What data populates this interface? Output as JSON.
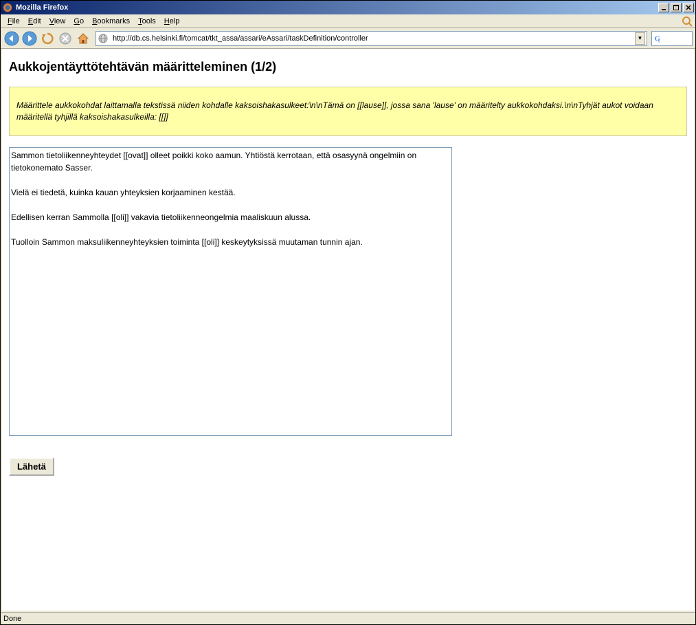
{
  "window": {
    "title": "Mozilla Firefox"
  },
  "menu": {
    "file": "File",
    "edit": "Edit",
    "view": "View",
    "go": "Go",
    "bookmarks": "Bookmarks",
    "tools": "Tools",
    "help": "Help"
  },
  "toolbar": {
    "url": "http://db.cs.helsinki.fi/tomcat/tkt_assa/assari/eAssari/taskDefinition/controller",
    "search_letter": "G"
  },
  "page": {
    "title": "Aukkojentäyttötehtävän määritteleminen (1/2)",
    "info": "Määrittele aukkokohdat laittamalla tekstissä niiden kohdalle kaksoishakasulkeet:\\n\\nTämä on [[lause]], jossa sana 'lause' on määritelty aukkokohdaksi.\\n\\nTyhjät aukot voidaan määritellä tyhjillä kaksoishakasulkeilla: [[]]",
    "textarea": "Sammon tietoliikenneyhteydet [[ovat]] olleet poikki koko aamun. Yhtiöstä kerrotaan, että osasyynä ongelmiin on tietokonemato Sasser.\n\nVielä ei tiedetä, kuinka kauan yhteyksien korjaaminen kestää.\n\nEdellisen kerran Sammolla [[oli]] vakavia tietoliikenneongelmia maaliskuun alussa.\n\nTuolloin Sammon maksuliikenneyhteyksien toiminta [[oli]] keskeytyksissä muutaman tunnin ajan.",
    "submit": "Lähetä"
  },
  "status": {
    "text": "Done"
  }
}
